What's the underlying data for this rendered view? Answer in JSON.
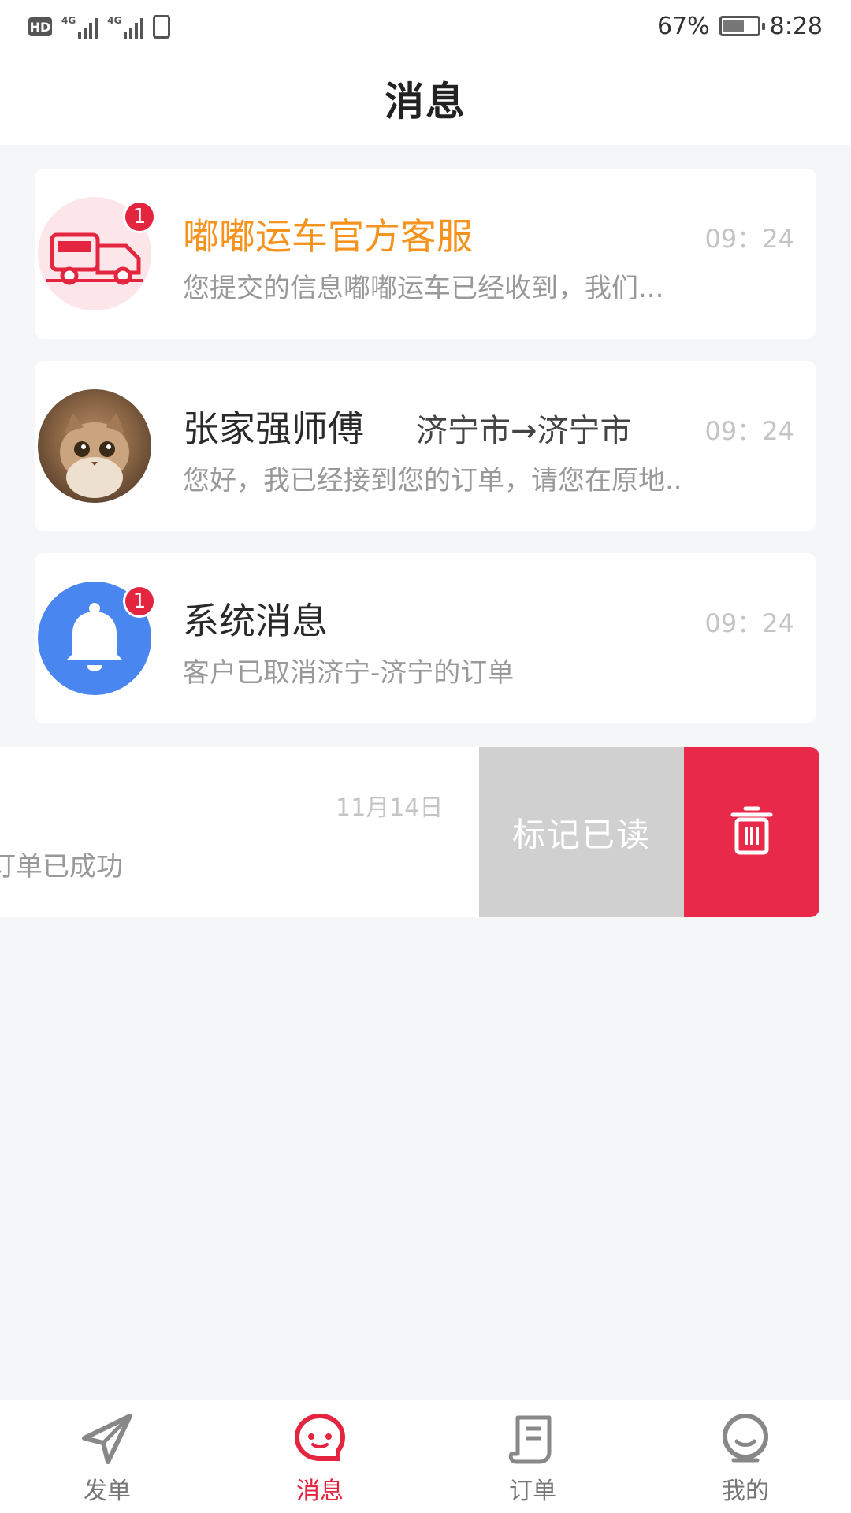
{
  "status_bar": {
    "hd": "HD",
    "network_1": "4G",
    "network_2": "4G",
    "battery_percent": "67%",
    "battery_level": 0.67,
    "time": "8:28"
  },
  "header": {
    "title": "消息"
  },
  "conversations": [
    {
      "name": "嘟嘟运车官方客服",
      "route": "",
      "time": "09：24",
      "preview": "您提交的信息嘟嘟运车已经收到，我们...",
      "unread": "1",
      "avatar": "truck-logo-icon"
    },
    {
      "name": "张家强师傅",
      "route": "济宁市→济宁市",
      "time": "09：24",
      "preview": "您好，我已经接到您的订单，请您在原地..",
      "unread": "",
      "avatar": "cat-photo"
    },
    {
      "name": "系统消息",
      "route": "",
      "time": "09：24",
      "preview": "客户已取消济宁-济宁的订单",
      "unread": "1",
      "avatar": "bell-icon"
    }
  ],
  "swiped_item": {
    "time": "11月14日",
    "preview": "订单已成功",
    "mark_read_label": "标记已读",
    "delete_icon": "trash-icon"
  },
  "tabbar": {
    "items": [
      {
        "label": "发单",
        "icon": "paper-plane-icon",
        "active": false
      },
      {
        "label": "消息",
        "icon": "chat-bubble-icon",
        "active": true
      },
      {
        "label": "订单",
        "icon": "order-document-icon",
        "active": false
      },
      {
        "label": "我的",
        "icon": "profile-face-icon",
        "active": false
      }
    ]
  },
  "colors": {
    "accent_red": "#e3253f",
    "official_orange": "#f6921e",
    "bell_blue": "#4a86f0",
    "delete_red": "#e8294a",
    "mark_read_gray": "#d0d0d0"
  }
}
